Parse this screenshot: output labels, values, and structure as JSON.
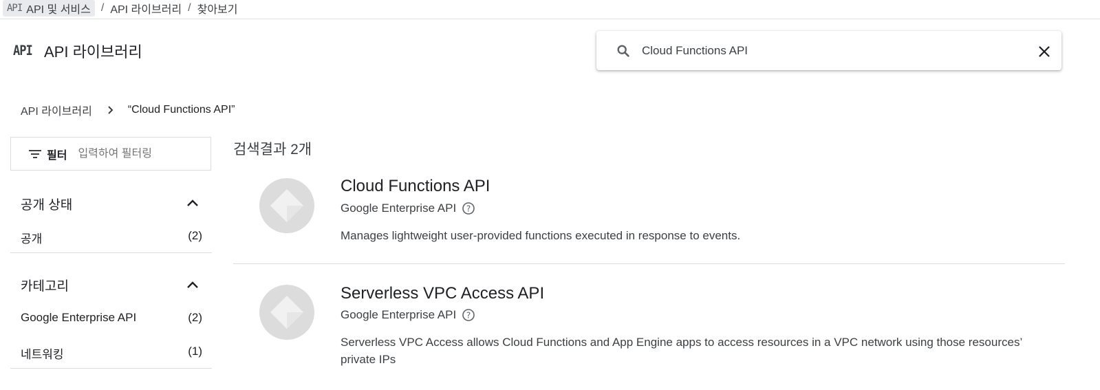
{
  "top_breadcrumb": {
    "badge": "API",
    "items": [
      "API 및 서비스",
      "API 라이브러리",
      "찾아보기"
    ],
    "separator": "/"
  },
  "header": {
    "logo": "API",
    "title": "API 라이브러리"
  },
  "search": {
    "value": "Cloud Functions API",
    "icon": "search-icon",
    "clear_icon": "close-icon"
  },
  "result_breadcrumb": {
    "root": "API 라이브러리",
    "current": "“Cloud Functions API”"
  },
  "filter": {
    "label": "필터",
    "placeholder": "입력하여 필터링"
  },
  "facets": [
    {
      "title": "공개 상태",
      "items": [
        {
          "label": "공개",
          "count": "(2)"
        }
      ]
    },
    {
      "title": "카테고리",
      "items": [
        {
          "label": "Google Enterprise API",
          "count": "(2)"
        },
        {
          "label": "네트워킹",
          "count": "(1)"
        }
      ]
    }
  ],
  "results": {
    "count_text": "검색결과 2개",
    "items": [
      {
        "title": "Cloud Functions API",
        "provider": "Google Enterprise API",
        "description": "Manages lightweight user-provided functions executed in response to events."
      },
      {
        "title": "Serverless VPC Access API",
        "provider": "Google Enterprise API",
        "description": "Serverless VPC Access allows Cloud Functions and App Engine apps to access resources in a VPC network using those resources’ private IPs"
      }
    ]
  },
  "colors": {
    "text_primary": "#202124",
    "text_secondary": "#3c4043",
    "divider": "#dadce0",
    "icon_gray": "#5f6368",
    "placeholder_circle": "#dcdcdc"
  }
}
